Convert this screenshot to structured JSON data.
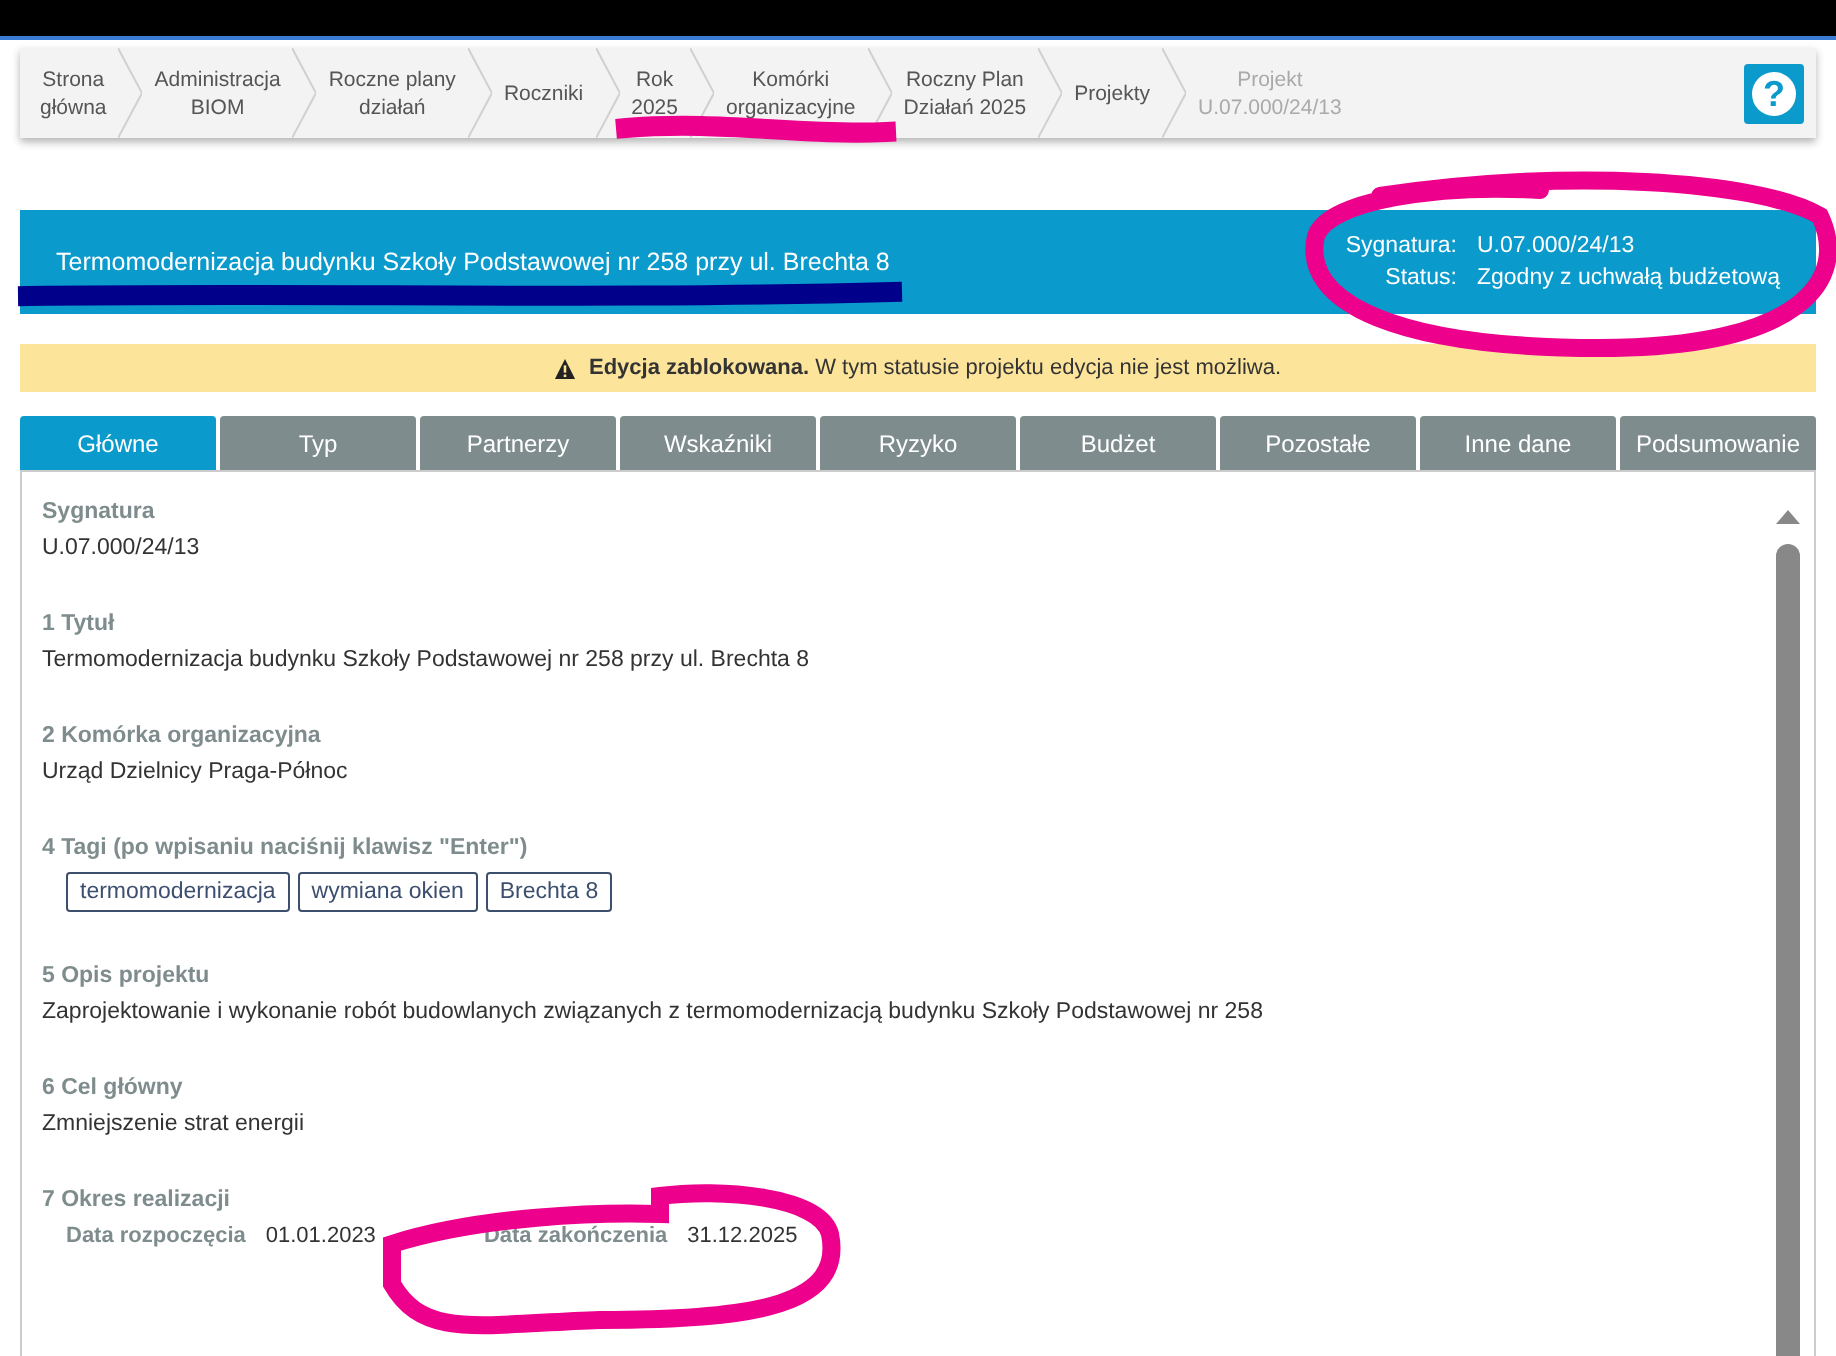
{
  "breadcrumbs": [
    {
      "label": "Strona główna",
      "disabled": false
    },
    {
      "label": "Administracja BIOM",
      "disabled": false
    },
    {
      "label": "Roczne plany działań",
      "disabled": false
    },
    {
      "label": "Roczniki",
      "disabled": false
    },
    {
      "label": "Rok 2025",
      "disabled": false
    },
    {
      "label": "Komórki organizacyjne",
      "disabled": false
    },
    {
      "label": "Roczny Plan Działań 2025",
      "disabled": false
    },
    {
      "label": "Projekty",
      "disabled": false
    },
    {
      "label": "Projekt U.07.000/24/13",
      "disabled": true
    }
  ],
  "help_button": {
    "label": "?"
  },
  "header": {
    "title": "Termomodernizacja budynku Szkoły Podstawowej nr 258 przy ul. Brechta 8",
    "signature_label": "Sygnatura:",
    "signature": "U.07.000/24/13",
    "status_label": "Status:",
    "status": "Zgodny z uchwałą budżetową"
  },
  "warning": {
    "text": "**Edycja zablokowana.** W tym statusie projektu edycja nie jest możliwa."
  },
  "tabs": [
    {
      "label": "Główne",
      "selected": true
    },
    {
      "label": "Typ",
      "selected": false
    },
    {
      "label": "Partnerzy",
      "selected": false
    },
    {
      "label": "Wskaźniki",
      "selected": false
    },
    {
      "label": "Ryzyko",
      "selected": false
    },
    {
      "label": "Budżet",
      "selected": false
    },
    {
      "label": "Pozostałe",
      "selected": false
    },
    {
      "label": "Inne dane",
      "selected": false
    },
    {
      "label": "Podsumowanie",
      "selected": false
    }
  ],
  "fields": [
    {
      "kind": "text",
      "label": "Sygnatura",
      "value": "U.07.000/24/13"
    },
    {
      "kind": "text",
      "label": "1 Tytuł",
      "value": "Termomodernizacja budynku Szkoły Podstawowej nr 258 przy ul. Brechta 8"
    },
    {
      "kind": "text",
      "label": "2 Komórka organizacyjna",
      "value": "Urząd Dzielnicy Praga-Północ"
    },
    {
      "kind": "tags",
      "label": "4 Tagi (po wpisaniu naciśnij klawisz \"Enter\")",
      "tags": [
        "termomodernizacja",
        "wymiana okien",
        "Brechta 8"
      ]
    },
    {
      "kind": "text",
      "label": "5 Opis projektu",
      "value": "Zaprojektowanie i wykonanie robót budowlanych związanych z termomodernizacją budynku Szkoły Podstawowej nr 258"
    },
    {
      "kind": "text",
      "label": "6 Cel główny",
      "value": "Zmniejszenie strat energii"
    },
    {
      "kind": "dates",
      "label": "7 Okres realizacji",
      "start_label": "Data rozpoczęcia",
      "start": "01.01.2023",
      "end_label": "Data zakończenia",
      "end": "31.12.2025"
    }
  ],
  "annotations": [
    {
      "kind": "underline",
      "color": "#ec008c"
    },
    {
      "kind": "underline",
      "color": "#00008b"
    },
    {
      "kind": "loop",
      "color": "#ec008c"
    },
    {
      "kind": "loop",
      "color": "#ec008c"
    }
  ]
}
